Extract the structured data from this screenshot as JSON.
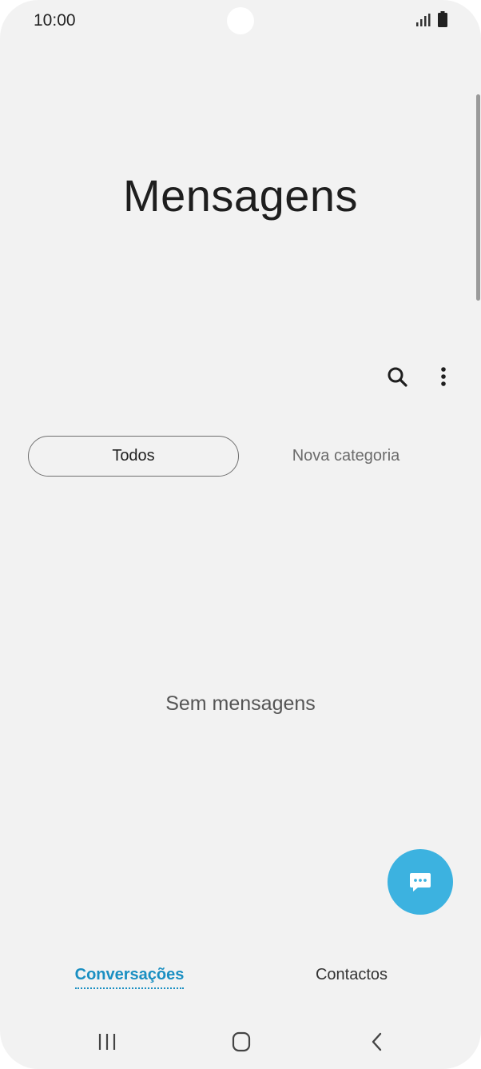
{
  "status_bar": {
    "time": "10:00",
    "icons": [
      "signal-icon",
      "battery-icon"
    ]
  },
  "app": {
    "title": "Mensagens"
  },
  "toolbar": {
    "icons": [
      "search-icon",
      "more-vert-icon"
    ]
  },
  "category_tabs": [
    {
      "label": "Todos",
      "selected": true
    },
    {
      "label": "Nova categoria",
      "selected": false
    }
  ],
  "empty_state": {
    "text": "Sem mensagens"
  },
  "fab": {
    "icon": "new-message-icon",
    "color": "#3cb2e0"
  },
  "bottom_tabs": [
    {
      "label": "Conversações",
      "selected": true
    },
    {
      "label": "Contactos",
      "selected": false
    }
  ],
  "nav_bar": {
    "icons": [
      "recent-apps-icon",
      "home-icon",
      "back-icon"
    ]
  },
  "colors": {
    "accent": "#1a8fc2",
    "fab": "#3cb2e0",
    "background": "#f2f2f2"
  }
}
